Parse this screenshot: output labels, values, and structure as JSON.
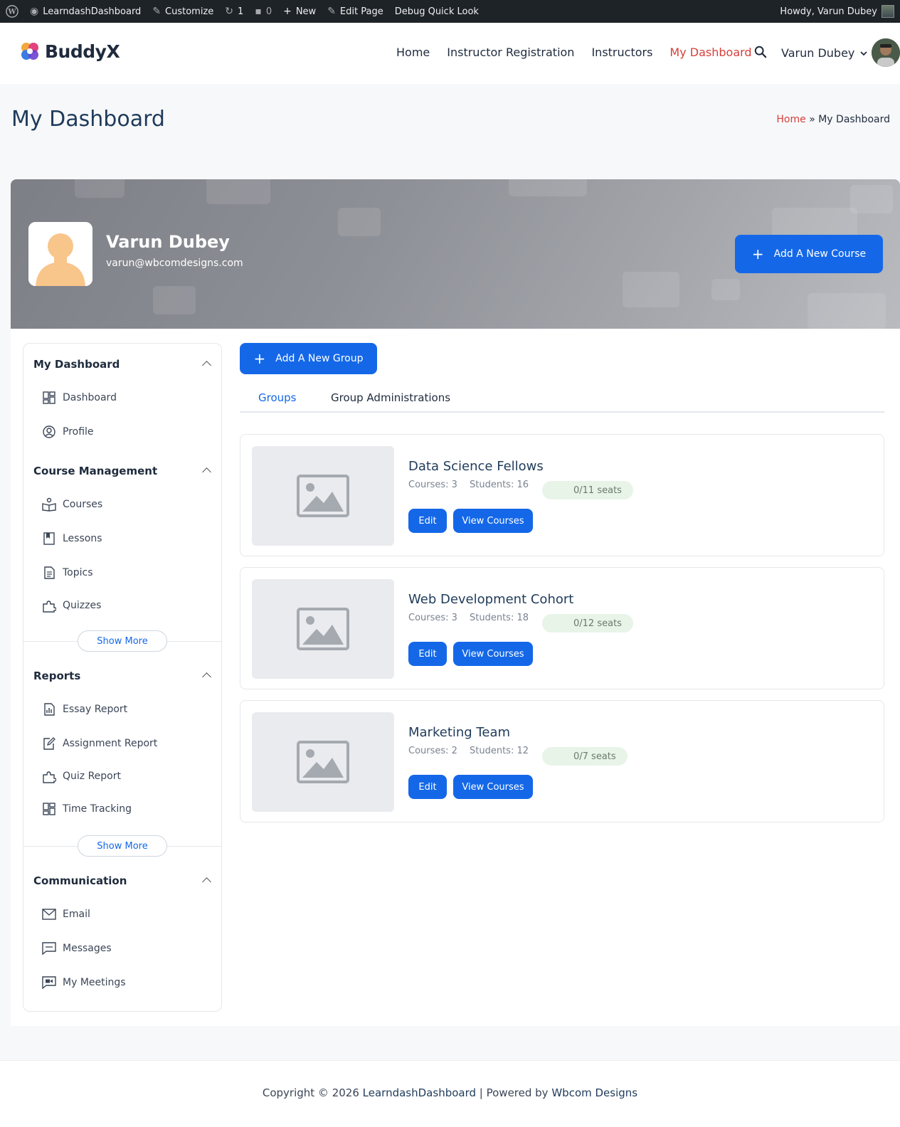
{
  "adminbar": {
    "site": "LearndashDashboard",
    "customize": "Customize",
    "updates": "1",
    "comments": "0",
    "new": "New",
    "edit_page": "Edit Page",
    "debug": "Debug Quick Look",
    "howdy": "Howdy, Varun Dubey"
  },
  "header": {
    "logo": "BuddyX",
    "nav": [
      "Home",
      "Instructor Registration",
      "Instructors",
      "My Dashboard"
    ],
    "user": "Varun Dubey"
  },
  "page": {
    "title": "My Dashboard",
    "breadcrumb_home": "Home",
    "breadcrumb_sep": "»",
    "breadcrumb_current": "My Dashboard"
  },
  "profile": {
    "name": "Varun Dubey",
    "email": "varun@wbcomdesigns.com",
    "add_course": "Add A New Course"
  },
  "sidebar": {
    "sections": [
      {
        "title": "My Dashboard",
        "items": [
          "Dashboard",
          "Profile"
        ]
      },
      {
        "title": "Course Management",
        "items": [
          "Courses",
          "Lessons",
          "Topics",
          "Quizzes"
        ],
        "more": "Show More"
      },
      {
        "title": "Reports",
        "items": [
          "Essay Report",
          "Assignment Report",
          "Quiz Report",
          "Time Tracking"
        ],
        "more": "Show More"
      },
      {
        "title": "Communication",
        "items": [
          "Email",
          "Messages",
          "My Meetings"
        ]
      }
    ]
  },
  "content": {
    "add_group": "Add A New Group",
    "tabs": [
      "Groups",
      "Group Administrations"
    ],
    "groups": [
      {
        "title": "Data Science Fellows",
        "courses": "Courses: 3",
        "students": "Students: 16",
        "seats": "0/11 seats",
        "edit": "Edit",
        "view": "View Courses"
      },
      {
        "title": "Web Development Cohort",
        "courses": "Courses: 3",
        "students": "Students: 18",
        "seats": "0/12 seats",
        "edit": "Edit",
        "view": "View Courses"
      },
      {
        "title": "Marketing Team",
        "courses": "Courses: 2",
        "students": "Students: 12",
        "seats": "0/7 seats",
        "edit": "Edit",
        "view": "View Courses"
      }
    ]
  },
  "footer": {
    "prefix": "Copyright © 2026",
    "site": "LearndashDashboard",
    "mid": "| Powered by",
    "company": "Wbcom Designs"
  },
  "colors": {
    "accent": "#1468e8",
    "active_nav": "#d6403a"
  }
}
